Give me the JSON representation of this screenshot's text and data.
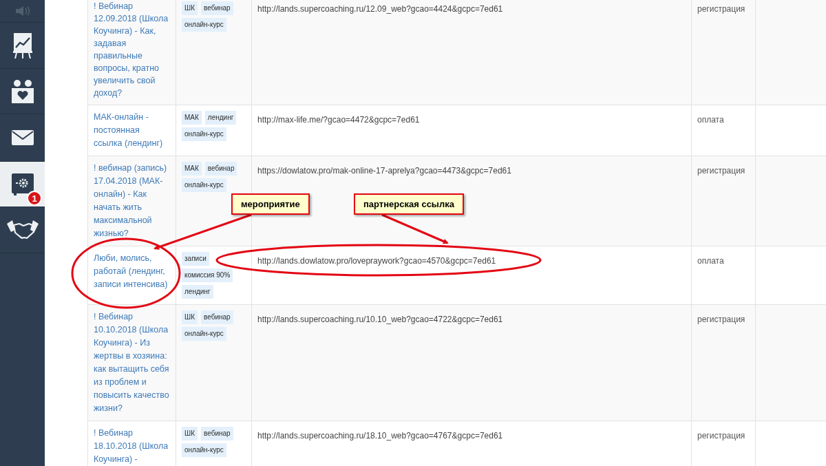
{
  "sidebar": {
    "items": [
      {
        "selected": false
      },
      {
        "selected": false
      },
      {
        "selected": false
      },
      {
        "selected": false
      },
      {
        "selected": true,
        "badge": "1"
      },
      {
        "selected": false
      }
    ]
  },
  "table": {
    "rows": [
      {
        "title": "! Вебинар 12.09.2018 (Школа Коучинга) - Как, задавая правильные вопросы, кратно увеличить свой доход?",
        "tags": [
          "ШК",
          "вебинар",
          "онлайн-курс"
        ],
        "url": "http://lands.supercoaching.ru/12.09_web?gcao=4424&gcpc=7ed61",
        "type": "регистрация"
      },
      {
        "title": "МАК-онлайн - постоянная ссылка (лендинг)",
        "tags": [
          "МАК",
          "лендинг",
          "онлайн-курс"
        ],
        "url": "http://max-life.me/?gcao=4472&gcpc=7ed61",
        "type": "оплата"
      },
      {
        "title": "! вебинар (запись) 17.04.2018 (МАК-онлайн) - Как начать жить максимальной жизнью?",
        "tags": [
          "МАК",
          "вебинар",
          "онлайн-курс"
        ],
        "url": "https://dowlatow.pro/mak-online-17-aprelya?gcao=4473&gcpc=7ed61",
        "type": "регистрация"
      },
      {
        "title": "Люби, молись, работай (лендинг, записи интенсива)",
        "tags": [
          "записи",
          "комиссия 90%",
          "лендинг"
        ],
        "url": "http://lands.dowlatow.pro/lovepraywork?gcao=4570&gcpc=7ed61",
        "type": "оплата"
      },
      {
        "title": "! Вебинар 10.10.2018 (Школа Коучинга) - Из жертвы в хозяина: как вытащить себя из проблем и повысить качество жизни?",
        "tags": [
          "ШК",
          "вебинар",
          "онлайн-курс"
        ],
        "url": "http://lands.supercoaching.ru/10.10_web?gcao=4722&gcpc=7ed61",
        "type": "регистрация"
      },
      {
        "title": "! Вебинар 18.10.2018 (Школа Коучинга) -",
        "tags": [
          "ШК",
          "вебинар",
          "онлайн-курс"
        ],
        "url": "http://lands.supercoaching.ru/18.10_web?gcao=4767&gcpc=7ed61",
        "type": "регистрация"
      }
    ]
  },
  "annotations": [
    {
      "label": "мероприятие"
    },
    {
      "label": "партнерская ссылка"
    }
  ]
}
